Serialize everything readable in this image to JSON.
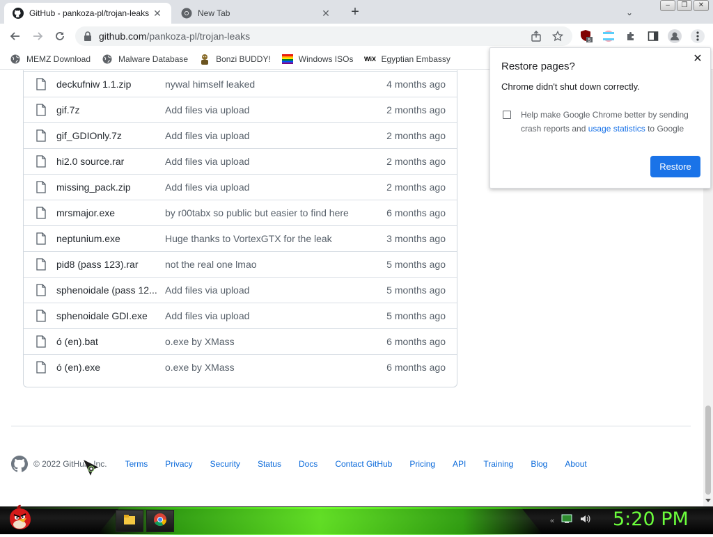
{
  "browser": {
    "tabs": [
      {
        "title": "GitHub - pankoza-pl/trojan-leaks",
        "active": true,
        "icon": "github-icon"
      },
      {
        "title": "New Tab",
        "active": false,
        "icon": "chrome-icon"
      }
    ],
    "url_host": "github.com",
    "url_path": "/pankoza-pl/trojan-leaks",
    "extension_badge": "5"
  },
  "bookmarks": [
    {
      "label": "MEMZ Download",
      "icon": "globe-icon"
    },
    {
      "label": "Malware Database",
      "icon": "globe-icon"
    },
    {
      "label": "Bonzi BUDDY!",
      "icon": "bonzi-icon"
    },
    {
      "label": "Windows ISOs",
      "icon": "windows-flag-icon"
    },
    {
      "label": "Egyptian Embassy",
      "icon": "wix-icon"
    }
  ],
  "files": [
    {
      "name": "deckufniw 1.1.zip",
      "message": "nywal himself leaked",
      "age": "4 months ago"
    },
    {
      "name": "gif.7z",
      "message": "Add files via upload",
      "age": "2 months ago"
    },
    {
      "name": "gif_GDIOnly.7z",
      "message": "Add files via upload",
      "age": "2 months ago"
    },
    {
      "name": "hi2.0 source.rar",
      "message": "Add files via upload",
      "age": "2 months ago"
    },
    {
      "name": "missing_pack.zip",
      "message": "Add files via upload",
      "age": "2 months ago"
    },
    {
      "name": "mrsmajor.exe",
      "message": "by r00tabx so public but easier to find here",
      "age": "6 months ago"
    },
    {
      "name": "neptunium.exe",
      "message": "Huge thanks to VortexGTX for the leak",
      "age": "3 months ago"
    },
    {
      "name": "pid8 (pass 123).rar",
      "message": "not the real one lmao",
      "age": "5 months ago"
    },
    {
      "name": "sphenoidale (pass 12...",
      "message": "Add files via upload",
      "age": "5 months ago"
    },
    {
      "name": "sphenoidale GDI.exe",
      "message": "Add files via upload",
      "age": "5 months ago"
    },
    {
      "name": "ó (en).bat",
      "message": "o.exe by XMass",
      "age": "6 months ago"
    },
    {
      "name": "ó (en).exe",
      "message": "o.exe by XMass",
      "age": "6 months ago"
    }
  ],
  "footer": {
    "copyright": "© 2022 GitHub, Inc.",
    "links": [
      "Terms",
      "Privacy",
      "Security",
      "Status",
      "Docs",
      "Contact GitHub",
      "Pricing",
      "API",
      "Training",
      "Blog",
      "About"
    ]
  },
  "restore_popup": {
    "title": "Restore pages?",
    "message": "Chrome didn't shut down correctly.",
    "help_text_before": "Help make Google Chrome better by sending crash reports and ",
    "help_link": "usage statistics",
    "help_text_after": " to Google",
    "button": "Restore"
  },
  "taskbar": {
    "clock": "5:20 PM",
    "apps": [
      "file-explorer-icon",
      "chrome-icon"
    ]
  },
  "colors": {
    "link": "#0969da",
    "restore_button": "#1a73e8",
    "clock": "#6cff3c"
  }
}
